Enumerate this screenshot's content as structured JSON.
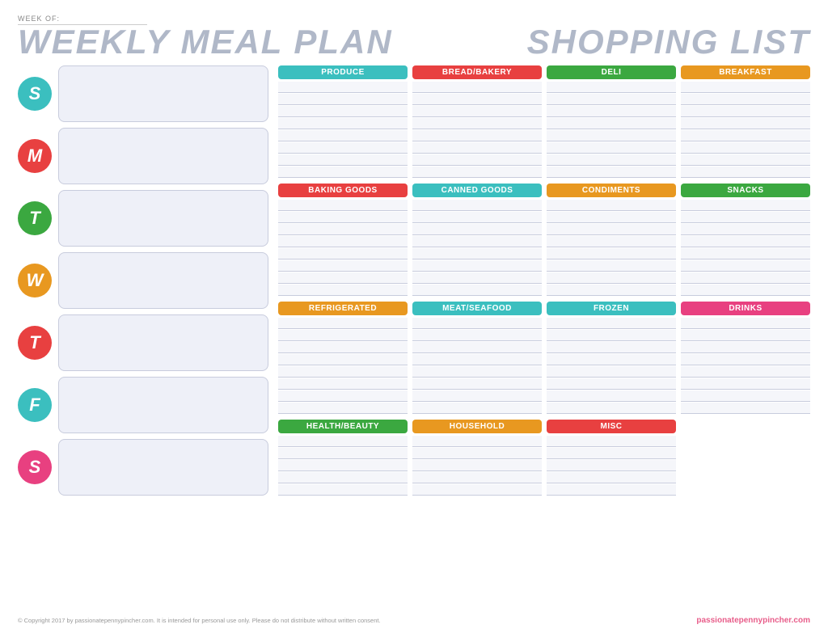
{
  "page": {
    "week_of_label": "WEEK OF:",
    "left_title": "WEEKLY MEAL PLAN",
    "right_title": "SHOPPING LIST",
    "footer_copyright": "© Copyright 2017 by passionatepennypincher.com. It is intended for personal use only. Please do not distribute without written consent.",
    "footer_brand": "passionatepennypincher.com"
  },
  "days": [
    {
      "letter": "S",
      "color": "circle-teal",
      "label": "Sunday"
    },
    {
      "letter": "M",
      "color": "circle-red",
      "label": "Monday"
    },
    {
      "letter": "T",
      "color": "circle-green",
      "label": "Tuesday"
    },
    {
      "letter": "W",
      "color": "circle-orange",
      "label": "Wednesday"
    },
    {
      "letter": "T",
      "color": "circle-red",
      "label": "Thursday"
    },
    {
      "letter": "F",
      "color": "circle-teal",
      "label": "Friday"
    },
    {
      "letter": "S",
      "color": "circle-pink",
      "label": "Saturday"
    }
  ],
  "shopping_rows": [
    [
      {
        "label": "PRODUCE",
        "color": "teal",
        "lines": 8
      },
      {
        "label": "BREAD/BAKERY",
        "color": "red",
        "lines": 8
      },
      {
        "label": "DELI",
        "color": "green",
        "lines": 8
      },
      {
        "label": "BREAKFAST",
        "color": "orange",
        "lines": 8
      }
    ],
    [
      {
        "label": "BAKING GOODS",
        "color": "red",
        "lines": 8
      },
      {
        "label": "CANNED GOODS",
        "color": "teal",
        "lines": 8
      },
      {
        "label": "CONDIMENTS",
        "color": "orange",
        "lines": 8
      },
      {
        "label": "SNACKS",
        "color": "green",
        "lines": 8
      }
    ],
    [
      {
        "label": "REFRIGERATED",
        "color": "orange",
        "lines": 8
      },
      {
        "label": "MEAT/SEAFOOD",
        "color": "teal",
        "lines": 8
      },
      {
        "label": "FROZEN",
        "color": "teal",
        "lines": 8
      },
      {
        "label": "DRINKS",
        "color": "pink",
        "lines": 8
      }
    ],
    [
      {
        "label": "HEALTH/BEAUTY",
        "color": "green",
        "lines": 5
      },
      {
        "label": "HOUSEHOLD",
        "color": "orange",
        "lines": 5
      },
      {
        "label": "MISC",
        "color": "red",
        "lines": 5
      },
      {
        "label": "",
        "color": "",
        "lines": 0
      }
    ]
  ]
}
